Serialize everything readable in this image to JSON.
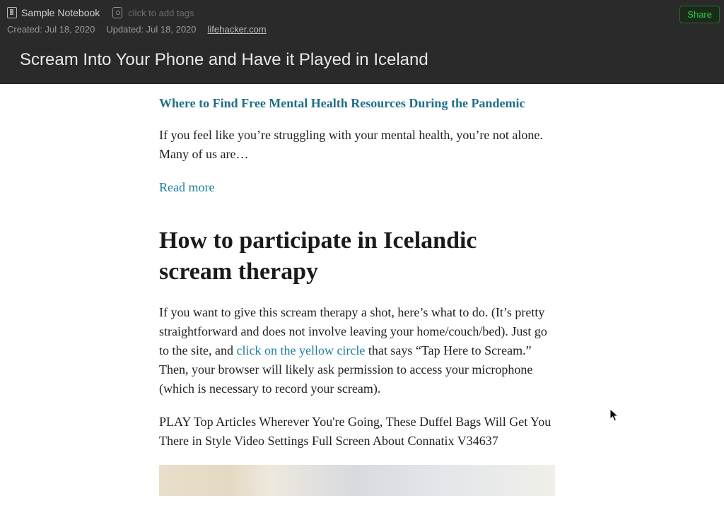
{
  "header": {
    "notebook_label": "Sample Notebook",
    "tags_placeholder": "click to add tags",
    "share_label": "Share"
  },
  "meta": {
    "created_label": "Created: Jul 18, 2020",
    "updated_label": "Updated: Jul 18, 2020",
    "source_link": "lifehacker.com"
  },
  "note": {
    "title": "Scream Into Your Phone and Have it Played in Iceland"
  },
  "article": {
    "related_link_title": "Where to Find Free Mental Health Resources During the Pandemic",
    "related_excerpt": "If you feel like you’re struggling with your mental health, you’re not alone. Many of us are…",
    "read_more_label": "Read more",
    "section_heading": "How to participate in Icelandic scream therapy",
    "body_part1": "If you want to give this scream therapy a shot, here’s what to do. (It’s pretty straightforward and does not involve leaving your home/couch/bed). Just go to the site, and ",
    "body_link": "click on the yellow circle",
    "body_part2": " that says “Tap Here to Scream.” Then, your browser will likely ask permission to access your microphone (which is necessary to record your scream).",
    "video_caption": "PLAY Top Articles Wherever You're Going, These Duffel Bags Will Get You There in Style Video Settings Full Screen About Connatix V34637"
  }
}
